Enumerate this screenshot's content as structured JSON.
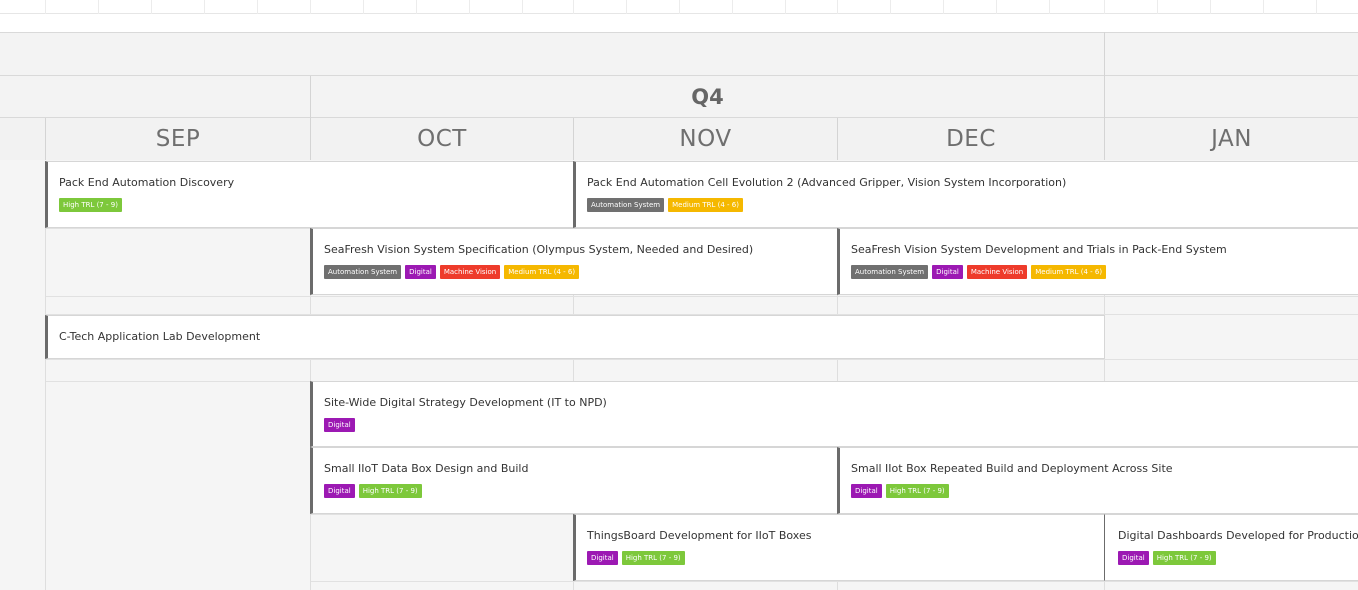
{
  "header": {
    "quarter": "Q4",
    "months": [
      "SEP",
      "OCT",
      "NOV",
      "DEC",
      "JAN"
    ]
  },
  "cards": [
    {
      "title": "Pack End Automation Discovery",
      "tags": [
        "High TRL (7 - 9)"
      ]
    },
    {
      "title": "Pack End Automation Cell Evolution 2 (Advanced Gripper, Vision System Incorporation)",
      "tags": [
        "Automation System",
        "Medium TRL (4 - 6)"
      ]
    },
    {
      "title": "SeaFresh Vision System Specification (Olympus System, Needed and Desired)",
      "tags": [
        "Automation System",
        "Digital",
        "Machine Vision",
        "Medium TRL (4 - 6)"
      ]
    },
    {
      "title": "SeaFresh Vision System Development and Trials in Pack-End System",
      "tags": [
        "Automation System",
        "Digital",
        "Machine Vision",
        "Medium TRL (4 - 6)"
      ]
    },
    {
      "title": "C-Tech Application Lab Development",
      "tags": []
    },
    {
      "title": "Site-Wide Digital Strategy Development (IT to NPD)",
      "tags": [
        "Digital"
      ]
    },
    {
      "title": "Small IIoT Data Box Design and Build",
      "tags": [
        "Digital",
        "High TRL (7 - 9)"
      ]
    },
    {
      "title": "Small IIot Box Repeated Build and Deployment Across Site",
      "tags": [
        "Digital",
        "High TRL (7 - 9)"
      ]
    },
    {
      "title": "ThingsBoard Development for IIoT Boxes",
      "tags": [
        "Digital",
        "High TRL (7 - 9)"
      ]
    },
    {
      "title": "Digital Dashboards Developed for Production",
      "tags": [
        "Digital",
        "High TRL (7 - 9)"
      ]
    }
  ],
  "colors": {
    "high_trl": "#7dc83b",
    "medium_trl": "#f5b800",
    "automation_system": "#707070",
    "digital": "#9c19b3",
    "machine_vision": "#ee3b2b"
  }
}
